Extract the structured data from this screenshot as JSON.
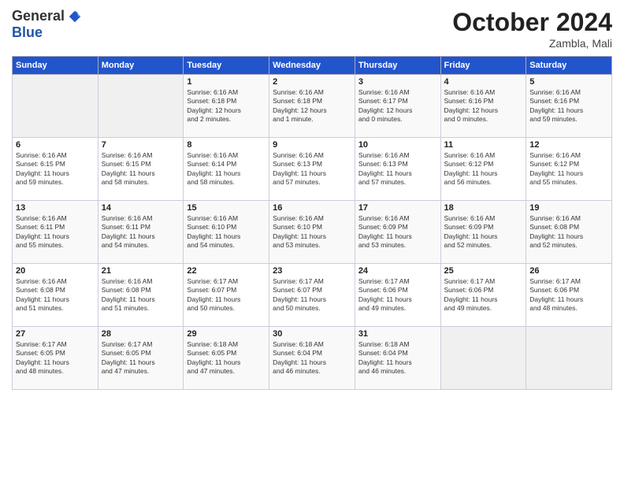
{
  "header": {
    "logo_general": "General",
    "logo_blue": "Blue",
    "month": "October 2024",
    "location": "Zambla, Mali"
  },
  "days_of_week": [
    "Sunday",
    "Monday",
    "Tuesday",
    "Wednesday",
    "Thursday",
    "Friday",
    "Saturday"
  ],
  "weeks": [
    [
      {
        "day": "",
        "text": ""
      },
      {
        "day": "",
        "text": ""
      },
      {
        "day": "1",
        "text": "Sunrise: 6:16 AM\nSunset: 6:18 PM\nDaylight: 12 hours\nand 2 minutes."
      },
      {
        "day": "2",
        "text": "Sunrise: 6:16 AM\nSunset: 6:18 PM\nDaylight: 12 hours\nand 1 minute."
      },
      {
        "day": "3",
        "text": "Sunrise: 6:16 AM\nSunset: 6:17 PM\nDaylight: 12 hours\nand 0 minutes."
      },
      {
        "day": "4",
        "text": "Sunrise: 6:16 AM\nSunset: 6:16 PM\nDaylight: 12 hours\nand 0 minutes."
      },
      {
        "day": "5",
        "text": "Sunrise: 6:16 AM\nSunset: 6:16 PM\nDaylight: 11 hours\nand 59 minutes."
      }
    ],
    [
      {
        "day": "6",
        "text": "Sunrise: 6:16 AM\nSunset: 6:15 PM\nDaylight: 11 hours\nand 59 minutes."
      },
      {
        "day": "7",
        "text": "Sunrise: 6:16 AM\nSunset: 6:15 PM\nDaylight: 11 hours\nand 58 minutes."
      },
      {
        "day": "8",
        "text": "Sunrise: 6:16 AM\nSunset: 6:14 PM\nDaylight: 11 hours\nand 58 minutes."
      },
      {
        "day": "9",
        "text": "Sunrise: 6:16 AM\nSunset: 6:13 PM\nDaylight: 11 hours\nand 57 minutes."
      },
      {
        "day": "10",
        "text": "Sunrise: 6:16 AM\nSunset: 6:13 PM\nDaylight: 11 hours\nand 57 minutes."
      },
      {
        "day": "11",
        "text": "Sunrise: 6:16 AM\nSunset: 6:12 PM\nDaylight: 11 hours\nand 56 minutes."
      },
      {
        "day": "12",
        "text": "Sunrise: 6:16 AM\nSunset: 6:12 PM\nDaylight: 11 hours\nand 55 minutes."
      }
    ],
    [
      {
        "day": "13",
        "text": "Sunrise: 6:16 AM\nSunset: 6:11 PM\nDaylight: 11 hours\nand 55 minutes."
      },
      {
        "day": "14",
        "text": "Sunrise: 6:16 AM\nSunset: 6:11 PM\nDaylight: 11 hours\nand 54 minutes."
      },
      {
        "day": "15",
        "text": "Sunrise: 6:16 AM\nSunset: 6:10 PM\nDaylight: 11 hours\nand 54 minutes."
      },
      {
        "day": "16",
        "text": "Sunrise: 6:16 AM\nSunset: 6:10 PM\nDaylight: 11 hours\nand 53 minutes."
      },
      {
        "day": "17",
        "text": "Sunrise: 6:16 AM\nSunset: 6:09 PM\nDaylight: 11 hours\nand 53 minutes."
      },
      {
        "day": "18",
        "text": "Sunrise: 6:16 AM\nSunset: 6:09 PM\nDaylight: 11 hours\nand 52 minutes."
      },
      {
        "day": "19",
        "text": "Sunrise: 6:16 AM\nSunset: 6:08 PM\nDaylight: 11 hours\nand 52 minutes."
      }
    ],
    [
      {
        "day": "20",
        "text": "Sunrise: 6:16 AM\nSunset: 6:08 PM\nDaylight: 11 hours\nand 51 minutes."
      },
      {
        "day": "21",
        "text": "Sunrise: 6:16 AM\nSunset: 6:08 PM\nDaylight: 11 hours\nand 51 minutes."
      },
      {
        "day": "22",
        "text": "Sunrise: 6:17 AM\nSunset: 6:07 PM\nDaylight: 11 hours\nand 50 minutes."
      },
      {
        "day": "23",
        "text": "Sunrise: 6:17 AM\nSunset: 6:07 PM\nDaylight: 11 hours\nand 50 minutes."
      },
      {
        "day": "24",
        "text": "Sunrise: 6:17 AM\nSunset: 6:06 PM\nDaylight: 11 hours\nand 49 minutes."
      },
      {
        "day": "25",
        "text": "Sunrise: 6:17 AM\nSunset: 6:06 PM\nDaylight: 11 hours\nand 49 minutes."
      },
      {
        "day": "26",
        "text": "Sunrise: 6:17 AM\nSunset: 6:06 PM\nDaylight: 11 hours\nand 48 minutes."
      }
    ],
    [
      {
        "day": "27",
        "text": "Sunrise: 6:17 AM\nSunset: 6:05 PM\nDaylight: 11 hours\nand 48 minutes."
      },
      {
        "day": "28",
        "text": "Sunrise: 6:17 AM\nSunset: 6:05 PM\nDaylight: 11 hours\nand 47 minutes."
      },
      {
        "day": "29",
        "text": "Sunrise: 6:18 AM\nSunset: 6:05 PM\nDaylight: 11 hours\nand 47 minutes."
      },
      {
        "day": "30",
        "text": "Sunrise: 6:18 AM\nSunset: 6:04 PM\nDaylight: 11 hours\nand 46 minutes."
      },
      {
        "day": "31",
        "text": "Sunrise: 6:18 AM\nSunset: 6:04 PM\nDaylight: 11 hours\nand 46 minutes."
      },
      {
        "day": "",
        "text": ""
      },
      {
        "day": "",
        "text": ""
      }
    ]
  ]
}
